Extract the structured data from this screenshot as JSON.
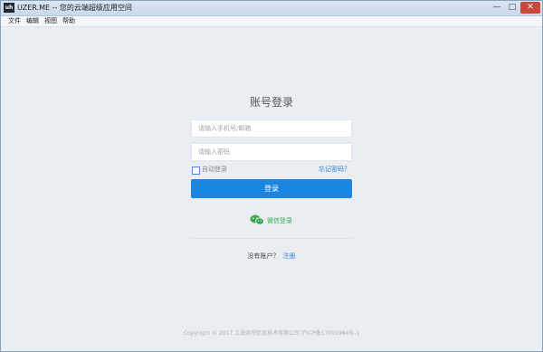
{
  "window": {
    "app_icon_text": "uh",
    "title": "UZER.ME -- 您的云端超级应用空间",
    "controls": [
      "—",
      "□",
      "✕"
    ]
  },
  "menu": [
    "文件",
    "编辑",
    "视图",
    "帮助"
  ],
  "login": {
    "heading": "账号登录",
    "account_placeholder": "请输入手机号/邮箱",
    "password_placeholder": "请输入密码",
    "remember_label": "自动登录",
    "forgot_label": "忘记密码？",
    "submit_label": "登录",
    "wechat_label": "微信登录",
    "no_account_text": "没有账户？",
    "register_label": "注册"
  },
  "footer": {
    "copyright": "Copyright © 2017 上海派视信息技术有限公司 沪ICP备17005984号-1"
  },
  "colors": {
    "accent": "#1a86e0",
    "wechat": "#39a94f",
    "background": "#eaeef3"
  }
}
